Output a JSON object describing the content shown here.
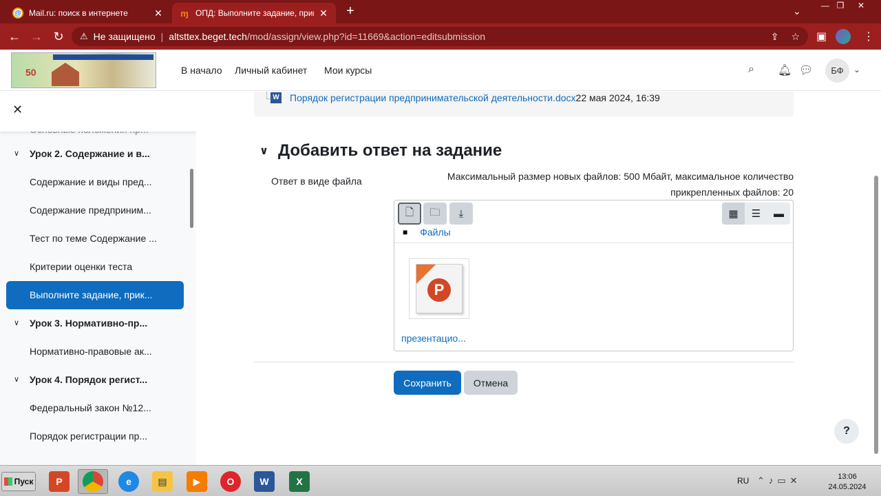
{
  "browser": {
    "tabs": [
      {
        "title": "Mail.ru: поиск в интернете",
        "favicon": "mailru-icon"
      },
      {
        "title": "ОПД: Выполните задание, прикре",
        "favicon": "moodle-icon"
      }
    ],
    "address": {
      "security": "Не защищено",
      "host": "altsttex.beget.tech",
      "path": "/mod/assign/view.php?id=11669&action=editsubmission"
    }
  },
  "header": {
    "nav": [
      "В начало",
      "Личный кабинет",
      "Мои курсы"
    ],
    "avatar_initials": "БФ"
  },
  "drawer": {
    "items": [
      {
        "type": "faded",
        "label": "Основные положения пр..."
      },
      {
        "type": "section",
        "label": "Урок 2. Содержание и в..."
      },
      {
        "type": "item",
        "label": "Содержание и виды пред..."
      },
      {
        "type": "item",
        "label": "Содержание предприним..."
      },
      {
        "type": "item",
        "label": "Тест по теме Содержание ..."
      },
      {
        "type": "item",
        "label": "Критерии оценки теста"
      },
      {
        "type": "active",
        "label": "Выполните задание, прик..."
      },
      {
        "type": "section",
        "label": "Урок 3. Нормативно-пр..."
      },
      {
        "type": "item",
        "label": "Нормативно-правовые ак..."
      },
      {
        "type": "section",
        "label": "Урок 4. Порядок регист..."
      },
      {
        "type": "item",
        "label": "Федеральный закон №12..."
      },
      {
        "type": "item",
        "label": "Порядок регистрации пр..."
      }
    ]
  },
  "main": {
    "attached_file": {
      "name": "Порядок регистрации предпринимательской деятельности.docx",
      "date": "22 мая 2024, 16:39"
    },
    "section_title": "Добавить ответ на задание",
    "file_label": "Ответ в виде файла",
    "max_info_line1": "Максимальный размер новых файлов: 500 Мбайт, максимальное количество",
    "max_info_line2": "прикрепленных файлов: 20",
    "breadcrumb": "Файлы",
    "file_thumb_name": "презентацио...",
    "save_label": "Сохранить",
    "cancel_label": "Отмена",
    "help_label": "?"
  },
  "taskbar": {
    "start_label": "Пуск",
    "lang": "RU",
    "time": "13:06",
    "date": "24.05.2024"
  },
  "colors": {
    "chrome_dark": "#7a1616",
    "chrome_active": "#9c1f1f",
    "moodle_blue": "#0f6cbf"
  }
}
